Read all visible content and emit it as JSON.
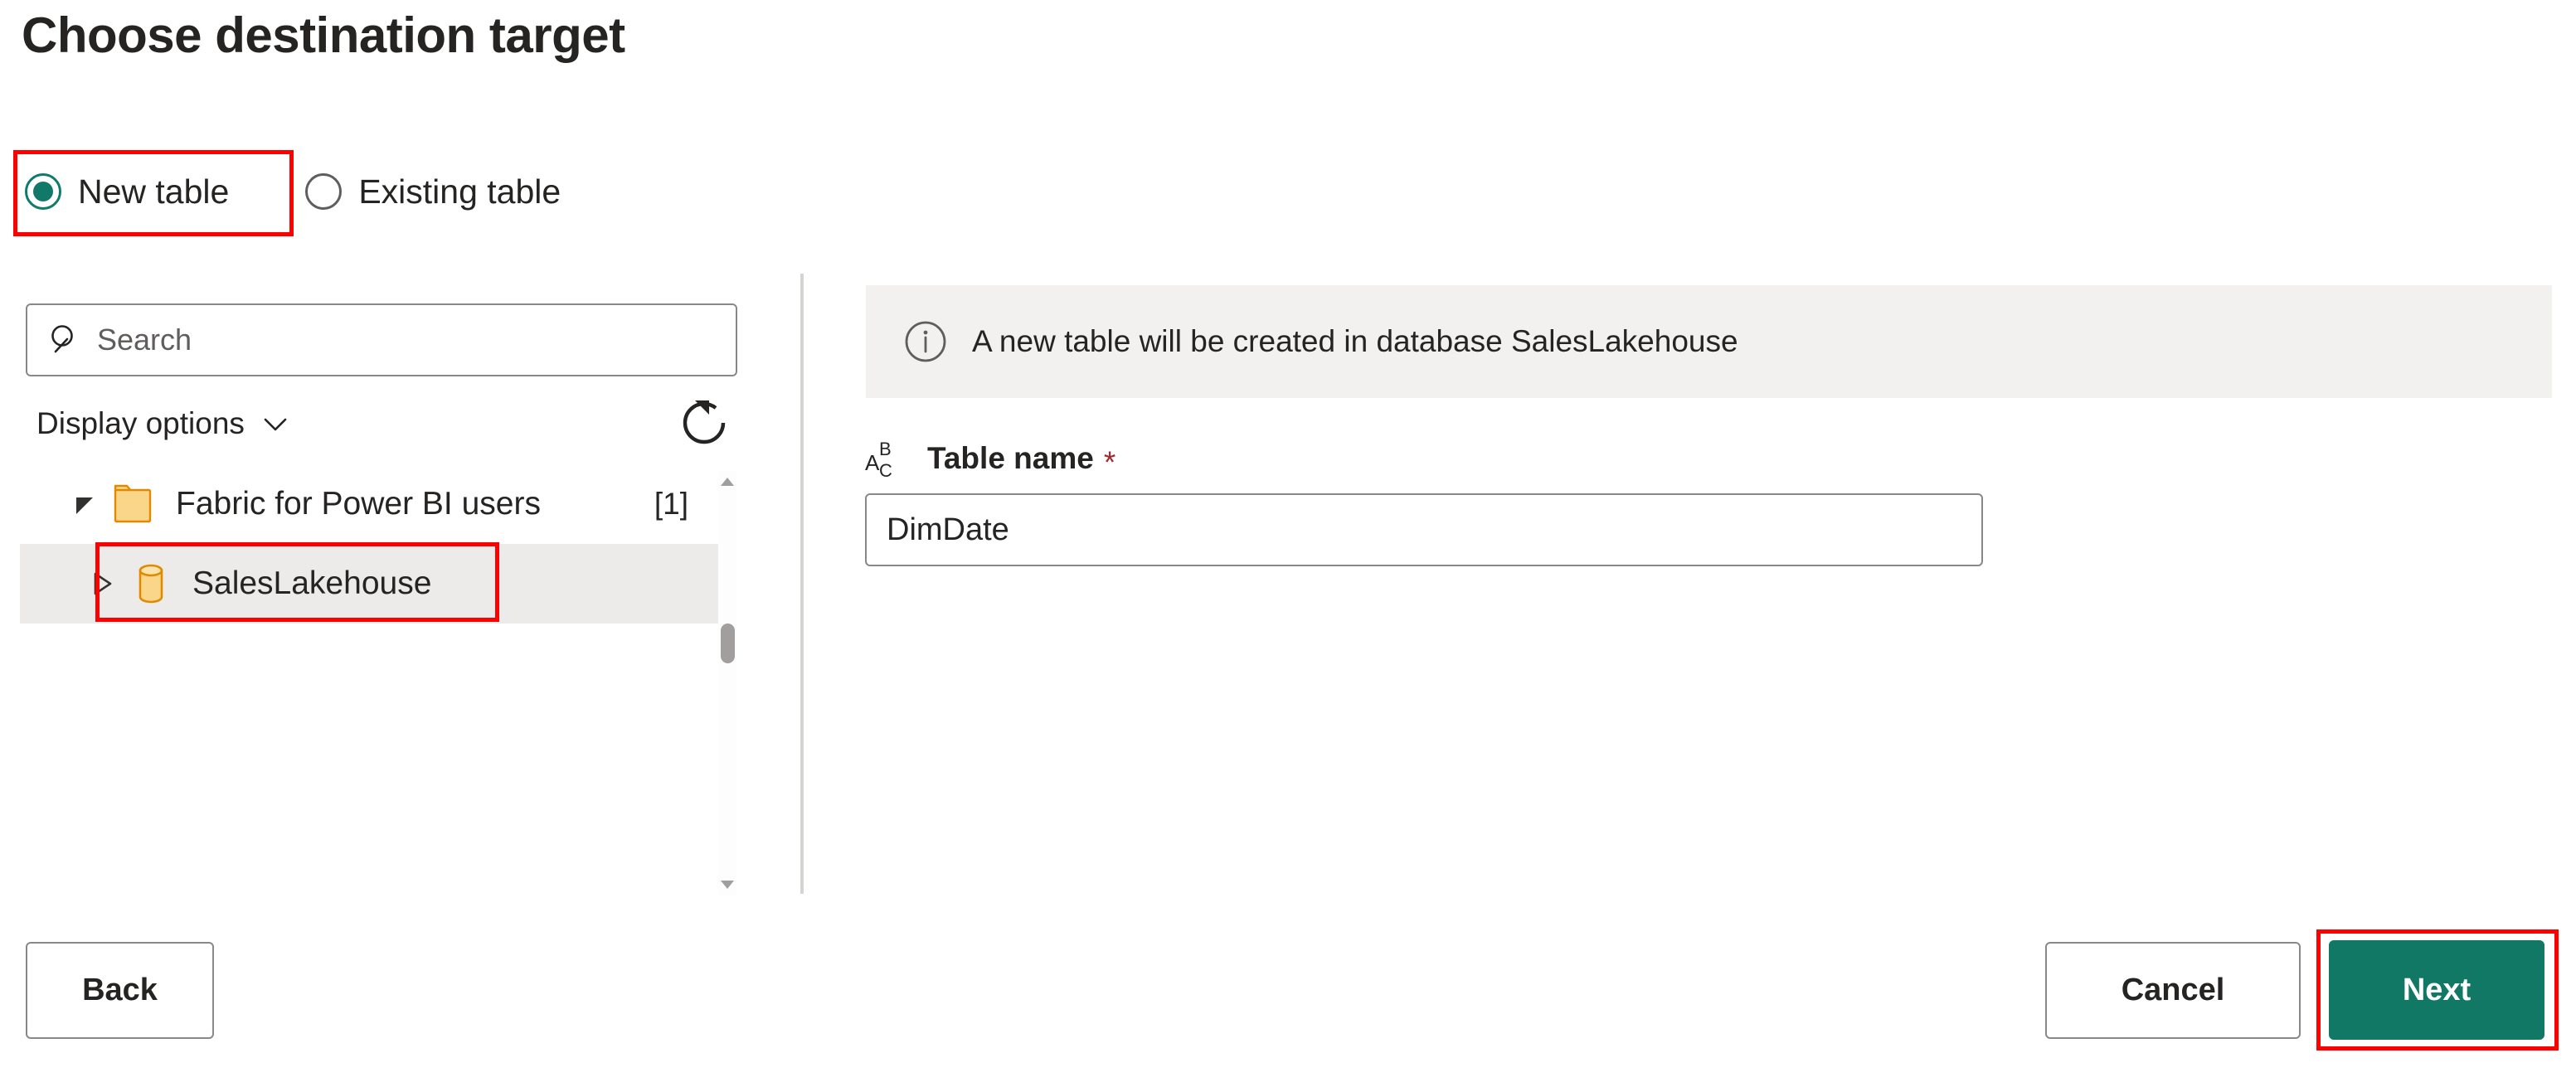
{
  "page": {
    "title": "Choose destination target"
  },
  "destination_mode": {
    "options": [
      {
        "label": "New table",
        "selected": true
      },
      {
        "label": "Existing table",
        "selected": false
      }
    ]
  },
  "left_panel": {
    "search": {
      "placeholder": "Search",
      "value": "",
      "icon": "search-icon"
    },
    "display_options": {
      "label": "Display options",
      "chevron_icon": "chevron-down-icon"
    },
    "refresh": {
      "icon": "refresh-icon",
      "tooltip": "Refresh"
    },
    "tree": [
      {
        "label": "Fabric for Power BI users",
        "count": "[1]",
        "icon": "folder-icon",
        "twisty": "expanded",
        "selected": false
      },
      {
        "label": "SalesLakehouse",
        "count": "",
        "icon": "database-icon",
        "twisty": "collapsed",
        "selected": true
      }
    ],
    "scrollbar": {
      "up_icon": "scroll-up-arrow-icon",
      "down_icon": "scroll-down-arrow-icon"
    }
  },
  "right_panel": {
    "info": {
      "icon": "info-icon",
      "message": "A new table will be created in database SalesLakehouse"
    },
    "table_name": {
      "icon": "abc-text-type-icon",
      "label": "Table name",
      "required_marker": "*",
      "value": "DimDate",
      "placeholder": ""
    }
  },
  "footer": {
    "back_label": "Back",
    "cancel_label": "Cancel",
    "next_label": "Next"
  },
  "annotations": [
    {
      "name": "new-table-radio-highlight",
      "color": "#FF0000"
    },
    {
      "name": "saleslakehouse-node-highlight",
      "color": "#FF0000"
    },
    {
      "name": "next-button-highlight",
      "color": "#FF0000"
    }
  ],
  "colors": {
    "accent_teal": "#117865",
    "radio_selected": "#12786A",
    "annotation_red": "#FF0000",
    "info_bar_bg": "#F2F1F0",
    "tree_selected_bg": "#EDEBE9",
    "required_red": "#A4262C",
    "folder_orange": "#E08A00",
    "folder_fill": "#FAD68A"
  }
}
